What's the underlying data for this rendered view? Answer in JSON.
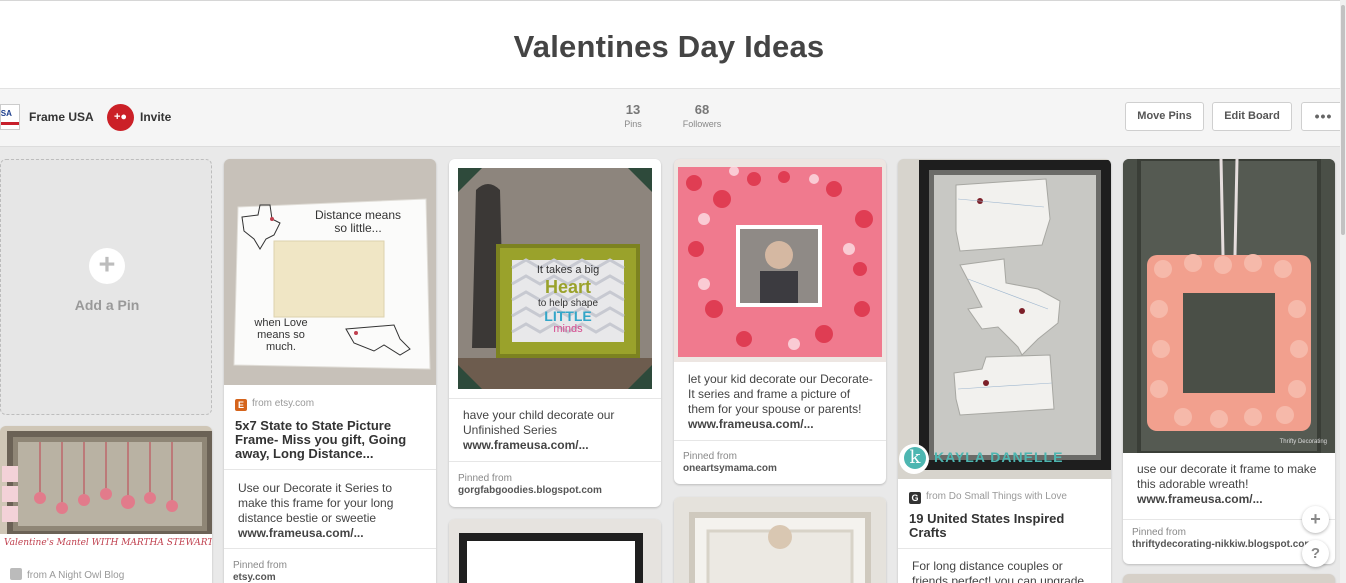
{
  "board": {
    "title": "Valentines Day Ideas"
  },
  "owner": {
    "name": "Frame USA",
    "avatar_text": "USA",
    "invite_label": "Invite",
    "invite_icon": "add-person-icon"
  },
  "stats": {
    "pins": "13",
    "pins_label": "Pins",
    "followers": "68",
    "followers_label": "Followers"
  },
  "actions": {
    "move_pins": "Move Pins",
    "edit_board": "Edit Board",
    "more": "•••"
  },
  "add_pin": {
    "label": "Add a Pin",
    "icon": "plus-icon"
  },
  "colors": {
    "invite_red": "#cb2027",
    "etsy_orange": "#d5641c"
  },
  "pins": [
    {
      "source": "from etsy.com",
      "title": "5x7 State to State Picture Frame- Miss you gift, Going away, Long Distance...",
      "description": "Use our Decorate it Series to make this frame for your long distance bestie or sweetie",
      "link": "www.frameusa.com/...",
      "pinned_from_label": "Pinned from",
      "pinned_from": "etsy.com",
      "image_text": {
        "line1": "Distance means",
        "line2": "so little...",
        "line3": "when Love",
        "line4": "means so much."
      }
    },
    {
      "description": "have your child decorate our Unfinished Series",
      "link": "www.frameusa.com/...",
      "pinned_from_label": "Pinned from",
      "pinned_from": "gorgfabgoodies.blogspot.com",
      "image_text": {
        "line1": "It takes a big",
        "line2": "Heart",
        "line3": "to help shape",
        "line4": "LITTLE",
        "line5": "minds"
      }
    },
    {
      "description": "let your kid decorate our Decorate-It series and frame a picture of them for your spouse or parents!",
      "link": "www.frameusa.com/...",
      "pinned_from_label": "Pinned from",
      "pinned_from": "oneartsymama.com"
    },
    {
      "source": "from Do Small Things with Love",
      "title": "19 United States Inspired Crafts",
      "description": "For long distance couples or friends perfect! you can upgrade",
      "image_text": {
        "watermark": "KAYLA DANELLE",
        "badge": "k"
      }
    },
    {
      "description": "use our decorate it frame to make this adorable wreath!",
      "link": "www.frameusa.com/...",
      "pinned_from_label": "Pinned from",
      "pinned_from": "thriftydecorating-nikkiw.blogspot.com",
      "image_text": {
        "credit": "Thrifty Decorating"
      }
    },
    {
      "source": "from A Night Owl Blog",
      "image_text": {
        "caption": "Valentine's Mantel WITH MARTHA STEWART CRAFTS"
      }
    }
  ],
  "fab": {
    "add_icon": "plus-icon",
    "help_icon": "question-icon",
    "help": "?"
  }
}
